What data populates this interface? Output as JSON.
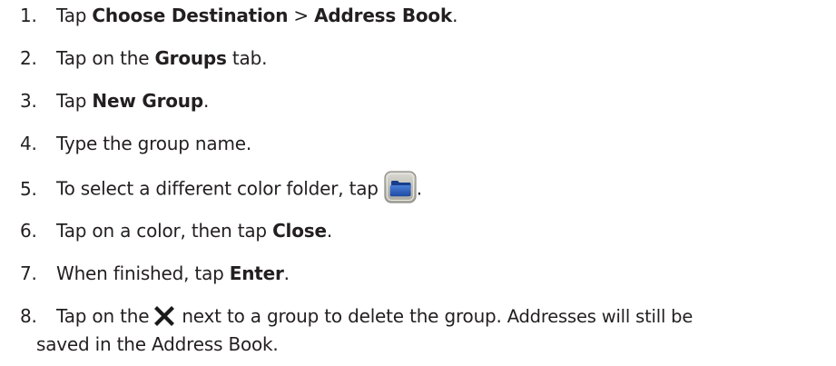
{
  "steps": [
    {
      "num": "1.",
      "pre": "Tap ",
      "b1": "Choose Destination",
      "mid": " > ",
      "b2": "Address Book",
      "post": "."
    },
    {
      "num": "2.",
      "pre": "Tap on the ",
      "b1": "Groups",
      "post": " tab."
    },
    {
      "num": "3.",
      "pre": "Tap ",
      "b1": "New Group",
      "post": "."
    },
    {
      "num": "4.",
      "text": "Type the group name."
    },
    {
      "num": "5.",
      "pre": "To select a different color folder, tap",
      "post": "."
    },
    {
      "num": "6.",
      "pre": "Tap on a color, then tap ",
      "b1": "Close",
      "post": "."
    },
    {
      "num": "7.",
      "pre": "When finished, tap ",
      "b1": "Enter",
      "post": "."
    },
    {
      "num": "8.",
      "pre": "Tap on the",
      "mid": "next to a group to delete the group.",
      "post": " Addresses will still be",
      "line2": "saved in the Address Book."
    }
  ],
  "icons": {
    "folder_button": "folder-icon",
    "delete": "x-icon"
  },
  "colors": {
    "text": "#231f20",
    "folder_blue": "#2b59b8",
    "button_gray": "#b8b8b0"
  }
}
